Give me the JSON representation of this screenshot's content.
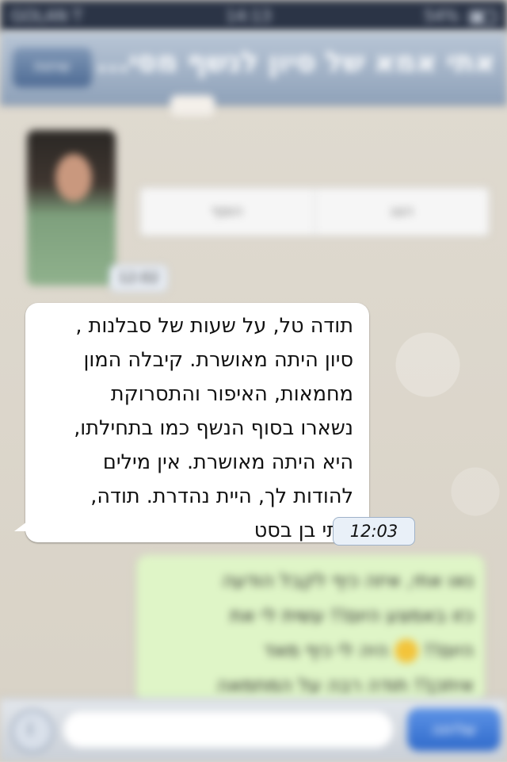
{
  "status_bar": {
    "carrier": "GOLAN T",
    "time": "14:13",
    "battery": "54%"
  },
  "nav": {
    "back_label": "שיחות",
    "title": "אתי אמא של סיון לנשף מסי..."
  },
  "contact_card": {
    "action_left": "הצג",
    "action_right": "הוסף",
    "time": "12:02"
  },
  "incoming_message": {
    "text": "תודה טל, על שעות של סבלנות ,\nסיון היתה מאושרת.  קיבלה המון\nמחמאות, האיפור והתסרוקת\nנשארו בסוף הנשף כמו בתחילתו,\nהיא היתה מאושרת. אין מילים\nלהודות לך, היית נהדרת. תודה,\nאתי בן בסט",
    "time": "12:03"
  },
  "outgoing_message": {
    "line1": "נאו אתי, איזה כיף לקבל הודעה",
    "line2": "כזו באמצע היום!! עשית לי את",
    "line3": "היום!!",
    "line3b": "היה לי כיף מאד",
    "line4": "איתכן!! תודה רבה על המחמאה"
  },
  "input_bar": {
    "send_label": "שליחה"
  },
  "colors": {
    "nav_gradient_top": "#b9c6d6",
    "outgoing_bubble": "#dff5c7",
    "send_button": "#2f6acb"
  }
}
